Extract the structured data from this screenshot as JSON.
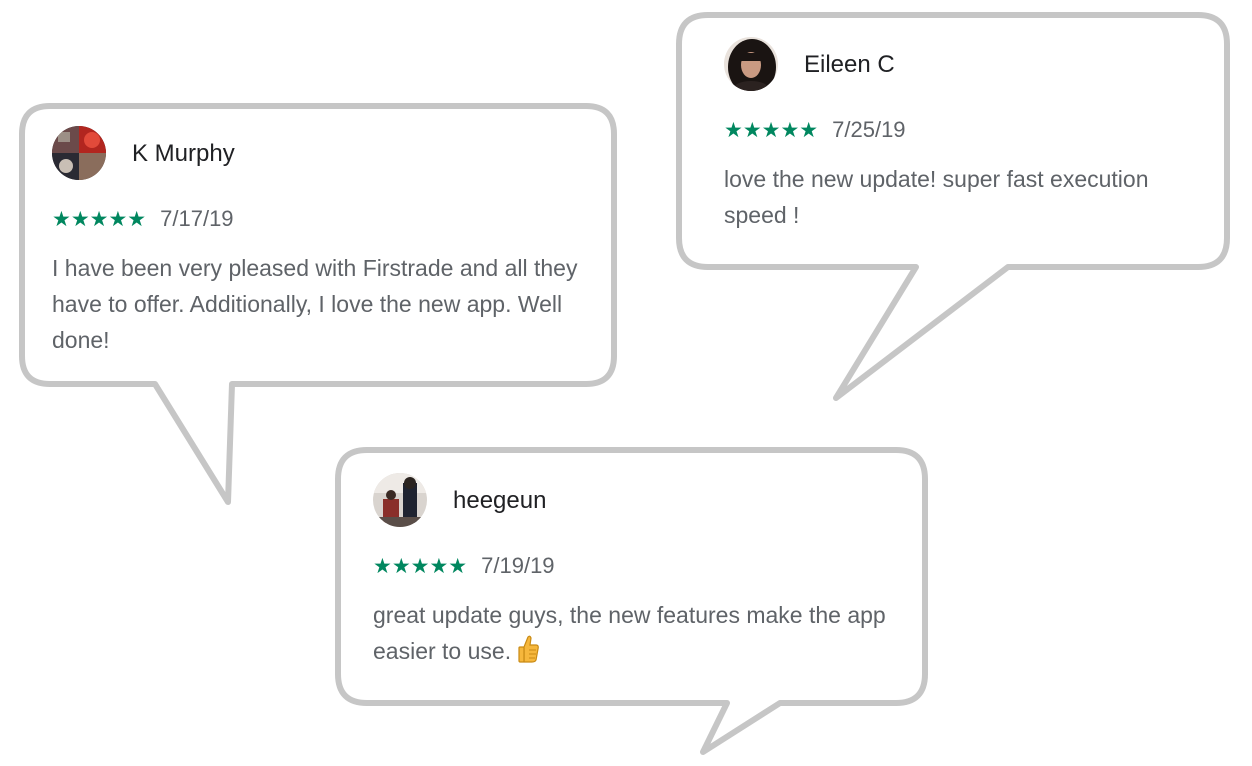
{
  "reviews": [
    {
      "name": "K Murphy",
      "stars": "★★★★★",
      "rating": 5,
      "date": "7/17/19",
      "text": "I have been very pleased with Firstrade and all they have to offer. Additionally, I love the new app. Well done!"
    },
    {
      "name": "Eileen C",
      "stars": "★★★★★",
      "rating": 5,
      "date": "7/25/19",
      "text": "love the new update! super fast execution speed !"
    },
    {
      "name": "heegeun",
      "stars": "★★★★★",
      "rating": 5,
      "date": "7/19/19",
      "text": "great update guys, the new features make the app easier to use.",
      "emoji_icon": "thumbs-up-icon"
    }
  ],
  "colors": {
    "star": "#01875f",
    "bubble_border": "#c6c6c6",
    "name": "#202124",
    "text": "#5f6368"
  }
}
